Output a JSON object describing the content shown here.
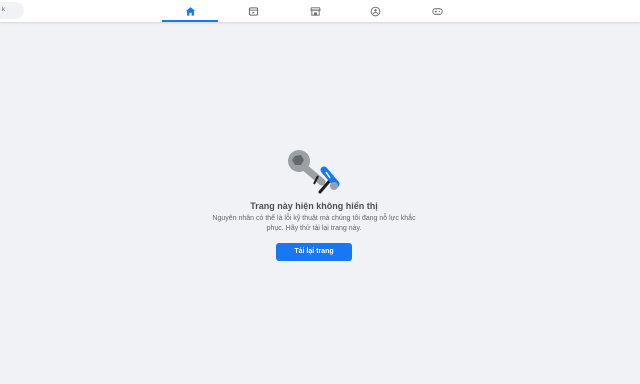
{
  "topbar": {
    "search_text": "k",
    "nav": [
      {
        "icon": "home-icon",
        "active": true
      },
      {
        "icon": "video-icon",
        "active": false
      },
      {
        "icon": "marketplace-icon",
        "active": false
      },
      {
        "icon": "groups-icon",
        "active": false
      },
      {
        "icon": "gaming-icon",
        "active": false
      }
    ]
  },
  "error": {
    "title": "Trang này hiện không hiển thị",
    "description": "Nguyên nhân có thể là lỗi kỹ thuật mà chúng tôi đang nỗ lực khắc phục. Hãy thử tải lại trang này.",
    "button_label": "Tải lại trang"
  },
  "colors": {
    "accent": "#1877f2",
    "background": "#f0f2f5",
    "icon": "#65676b"
  }
}
